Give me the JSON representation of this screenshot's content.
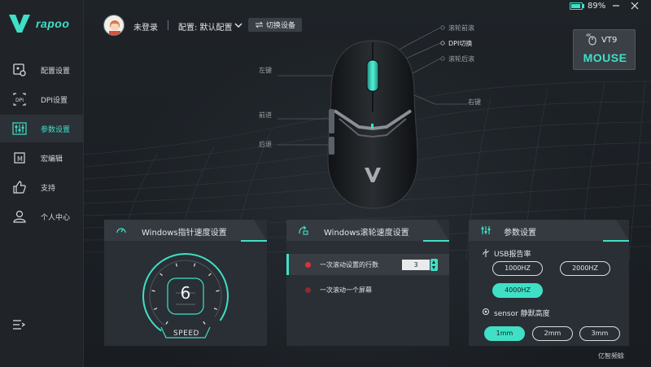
{
  "app": {
    "brand": "rapoo",
    "accent_color": "#3fe0c6"
  },
  "sidebar": {
    "items": [
      {
        "label": "配置设置",
        "icon": "config-icon",
        "active": false
      },
      {
        "label": "DPI设置",
        "icon": "dpi-icon",
        "active": false
      },
      {
        "label": "参数设置",
        "icon": "sliders-icon",
        "active": true
      },
      {
        "label": "宏编辑",
        "icon": "macro-icon",
        "active": false
      },
      {
        "label": "支持",
        "icon": "thumbs-up-icon",
        "active": false
      },
      {
        "label": "个人中心",
        "icon": "user-icon",
        "active": false
      }
    ],
    "menu_icon": "collapse-menu-icon"
  },
  "header": {
    "login_status": "未登录",
    "config_label": "配置: 默认配置",
    "switch_device_label": "切换设备",
    "battery_percent": "89%",
    "battery_level": 0.89
  },
  "device": {
    "model_name": "VT9",
    "model_type": "MOUSE",
    "badge": "4K"
  },
  "mouse_callouts": {
    "left_button": "左键",
    "right_button": "右键",
    "forward": "前进",
    "back": "后退",
    "scroll_forward": "滚轮前滚",
    "dpi_switch": "DPI切换",
    "scroll_back": "滚轮后滚"
  },
  "panels": {
    "pointer_speed": {
      "title": "Windows指针速度设置",
      "value": "6",
      "speed_label": "SPEED",
      "min": 1,
      "max": 10
    },
    "scroll_speed": {
      "title": "Windows滚轮速度设置",
      "rows": [
        {
          "label": "一次滚动设置的行数",
          "value": "3",
          "selected": true
        },
        {
          "label": "一次滚动一个屏幕",
          "selected": false
        }
      ]
    },
    "params": {
      "title": "参数设置",
      "usb_label": "USB报告率",
      "usb_options": [
        "1000HZ",
        "2000HZ",
        "4000HZ"
      ],
      "usb_selected": "4000HZ",
      "sensor_label": "sensor 静默高度",
      "sensor_options": [
        "1mm",
        "2mm",
        "3mm"
      ],
      "sensor_selected": "1mm"
    }
  },
  "watermark": "亿智频蜍"
}
